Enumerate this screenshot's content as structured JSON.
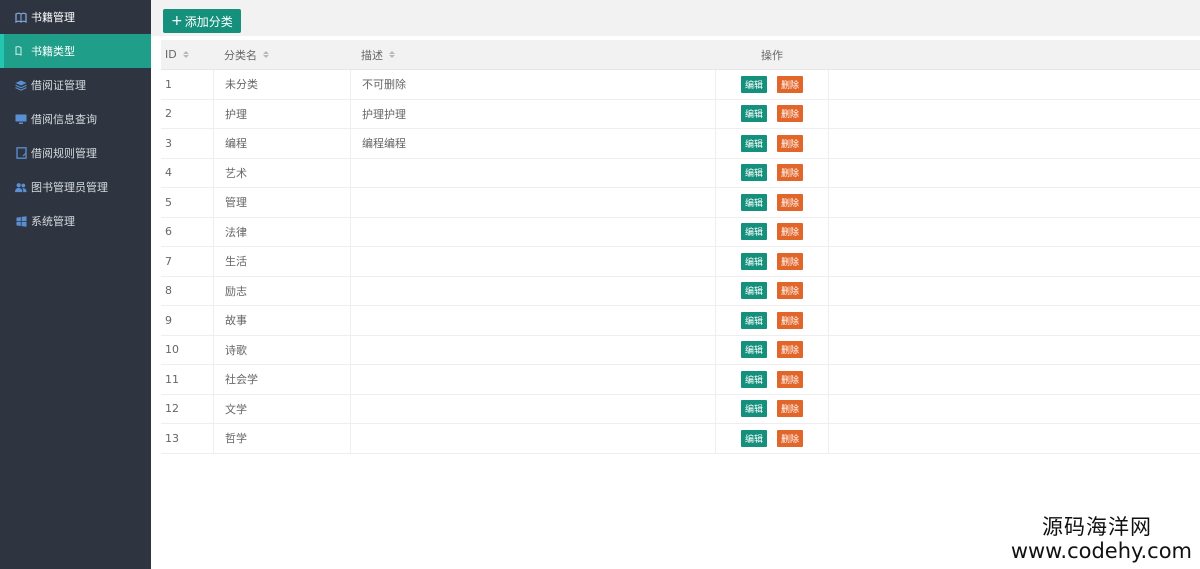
{
  "sidebar": {
    "items": [
      {
        "label": "书籍管理",
        "icon": "book-icon",
        "state": "group"
      },
      {
        "label": "书籍类型",
        "icon": "sub-item-icon",
        "state": "active"
      },
      {
        "label": "借阅证管理",
        "icon": "layers-icon",
        "state": "normal"
      },
      {
        "label": "借阅信息查询",
        "icon": "monitor-icon",
        "state": "normal"
      },
      {
        "label": "借阅规则管理",
        "icon": "document-icon",
        "state": "normal"
      },
      {
        "label": "图书管理员管理",
        "icon": "users-icon",
        "state": "normal"
      },
      {
        "label": "系统管理",
        "icon": "windows-icon",
        "state": "normal"
      }
    ]
  },
  "toolbar": {
    "add_label": "添加分类",
    "add_icon": "plus-icon"
  },
  "table": {
    "headers": {
      "id": "ID",
      "name": "分类名",
      "desc": "描述",
      "op": "操作"
    },
    "edit_label": "编辑",
    "delete_label": "删除",
    "rows": [
      {
        "id": "1",
        "name": "未分类",
        "desc": "不可删除"
      },
      {
        "id": "2",
        "name": "护理",
        "desc": "护理护理"
      },
      {
        "id": "3",
        "name": "编程",
        "desc": "编程编程"
      },
      {
        "id": "4",
        "name": "艺术",
        "desc": ""
      },
      {
        "id": "5",
        "name": "管理",
        "desc": ""
      },
      {
        "id": "6",
        "name": "法律",
        "desc": ""
      },
      {
        "id": "7",
        "name": "生活",
        "desc": ""
      },
      {
        "id": "8",
        "name": "励志",
        "desc": ""
      },
      {
        "id": "9",
        "name": "故事",
        "desc": ""
      },
      {
        "id": "10",
        "name": "诗歌",
        "desc": ""
      },
      {
        "id": "11",
        "name": "社会学",
        "desc": ""
      },
      {
        "id": "12",
        "name": "文学",
        "desc": ""
      },
      {
        "id": "13",
        "name": "哲学",
        "desc": ""
      }
    ]
  },
  "watermark": {
    "line1": "源码海洋网",
    "line2": "www.codehy.com"
  },
  "colors": {
    "sidebar_bg": "#2f3540",
    "active": "#1f9e8a",
    "primary": "#14907d",
    "danger": "#e2652a"
  }
}
